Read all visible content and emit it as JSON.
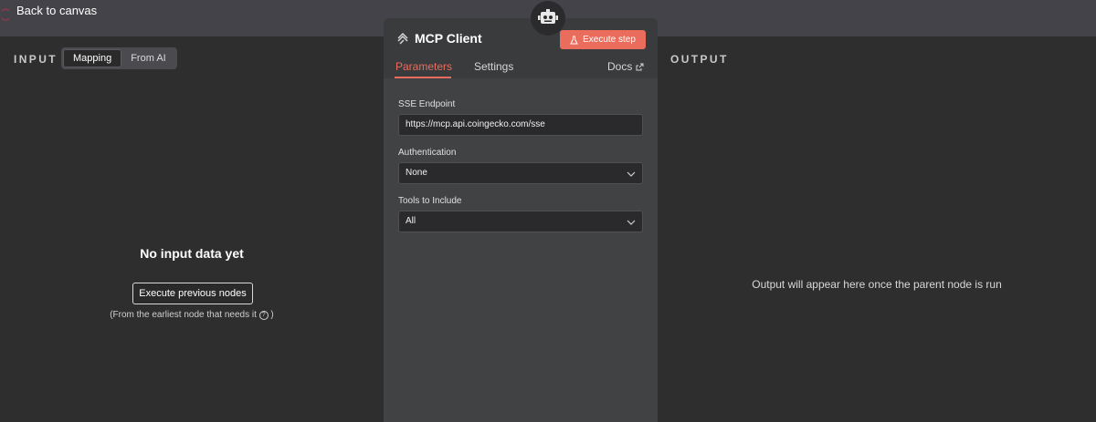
{
  "topbar": {
    "back_label": "Back to canvas"
  },
  "input": {
    "title": "INPUT",
    "tabs": [
      {
        "label": "Mapping",
        "active": true
      },
      {
        "label": "From AI",
        "active": false
      }
    ],
    "empty_title": "No input data yet",
    "exec_prev_label": "Execute previous nodes",
    "hint_text": "(From the earliest node that needs it",
    "hint_end": ")"
  },
  "node": {
    "title": "MCP Client",
    "exec_step_label": "Execute step",
    "tabs": [
      {
        "label": "Parameters",
        "active": true
      },
      {
        "label": "Settings",
        "active": false
      }
    ],
    "docs_label": "Docs",
    "fields": [
      {
        "label": "SSE Endpoint",
        "value": "https://mcp.api.coingecko.com/sse",
        "type": "text"
      },
      {
        "label": "Authentication",
        "value": "None",
        "type": "select"
      },
      {
        "label": "Tools to Include",
        "value": "All",
        "type": "select"
      }
    ]
  },
  "output": {
    "title": "OUTPUT",
    "empty_message": "Output will appear here once the parent node is run"
  },
  "colors": {
    "accent": "#ea6c5c",
    "topbar": "#434349",
    "panel": "#414244"
  }
}
